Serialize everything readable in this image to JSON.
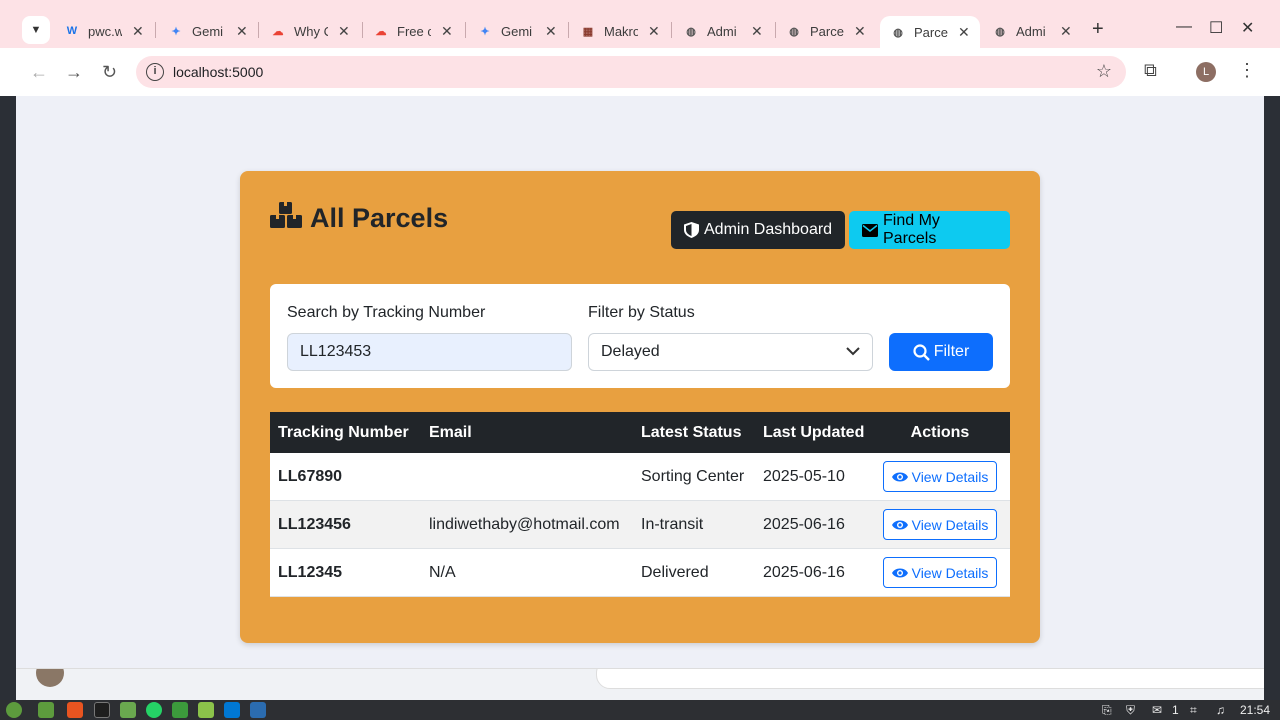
{
  "browser": {
    "tabs": [
      {
        "title": "pwc.w",
        "favicon": "word-icon"
      },
      {
        "title": "Gemi",
        "favicon": "gemini-icon"
      },
      {
        "title": "Why C",
        "favicon": "google-cloud-icon"
      },
      {
        "title": "Free c",
        "favicon": "google-cloud-icon"
      },
      {
        "title": "Gemi",
        "favicon": "gemini-icon"
      },
      {
        "title": "Makro",
        "favicon": "makro-icon"
      },
      {
        "title": "Admi",
        "favicon": "globe-icon"
      },
      {
        "title": "Parce",
        "favicon": "globe-icon"
      },
      {
        "title": "Parce",
        "favicon": "globe-icon",
        "active": true
      },
      {
        "title": "Admi",
        "favicon": "globe-icon"
      }
    ],
    "url": "localhost:5000",
    "profile_initial": "L"
  },
  "page": {
    "title": "All Parcels",
    "admin_button": "Admin Dashboard",
    "find_button": "Find My Parcels"
  },
  "filter": {
    "search_label": "Search by Tracking Number",
    "search_value": "LL123453",
    "status_label": "Filter by Status",
    "status_value": "Delayed",
    "filter_button": "Filter"
  },
  "table": {
    "headers": [
      "Tracking Number",
      "Email",
      "Latest Status",
      "Last Updated",
      "Actions"
    ],
    "rows": [
      {
        "tracking": "LL67890",
        "email": "",
        "status": "Sorting Center",
        "updated": "2025-05-10",
        "action": "View Details"
      },
      {
        "tracking": "LL123456",
        "email": "lindiwethaby@hotmail.com",
        "status": "In-transit",
        "updated": "2025-06-16",
        "action": "View Details"
      },
      {
        "tracking": "LL12345",
        "email": "N/A",
        "status": "Delivered",
        "updated": "2025-06-16",
        "action": "View Details"
      }
    ]
  },
  "taskbar": {
    "tray_count": "1",
    "clock": "21:54"
  },
  "colors": {
    "card_bg": "#e8a040",
    "primary": "#0d6efd",
    "info": "#0dcaf0",
    "dark": "#212529",
    "tabstrip": "#fde2e6"
  }
}
